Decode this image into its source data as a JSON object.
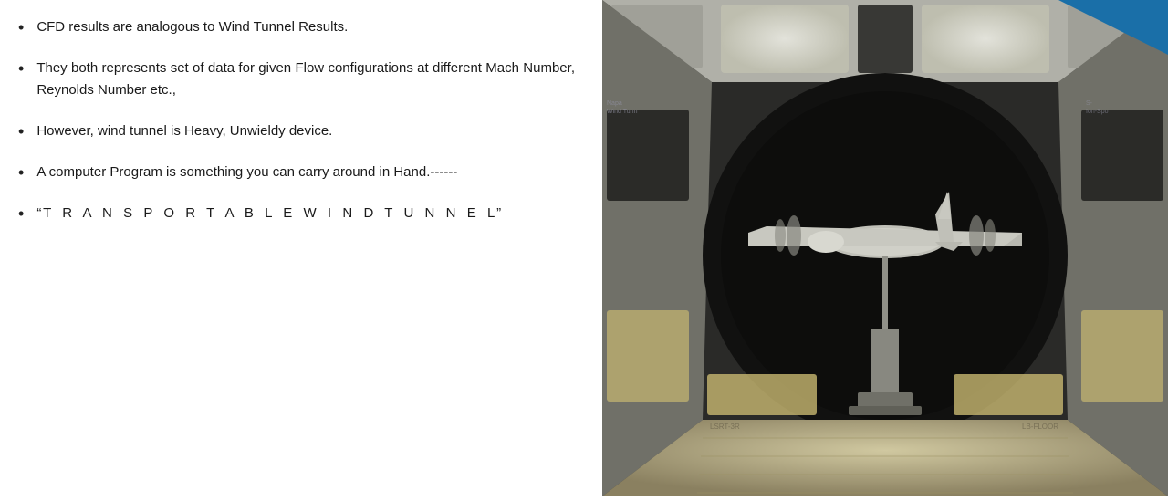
{
  "bullets": [
    {
      "id": "bullet-1",
      "text": "CFD results are analogous to Wind Tunnel Results."
    },
    {
      "id": "bullet-2",
      "text": "They both represents set of data for given Flow configurations at different Mach Number, Reynolds Number etc.,"
    },
    {
      "id": "bullet-3",
      "text": "However, wind tunnel is  Heavy, Unwieldy device."
    },
    {
      "id": "bullet-4",
      "text": "A computer Program is something you can carry around in Hand.------"
    },
    {
      "id": "bullet-5",
      "text": "“T R A N S P O R T A B L E   W I N D   T U N N E L”"
    }
  ],
  "accent_color": "#1a6fa8",
  "image_alt": "Wind tunnel interior with aircraft model"
}
